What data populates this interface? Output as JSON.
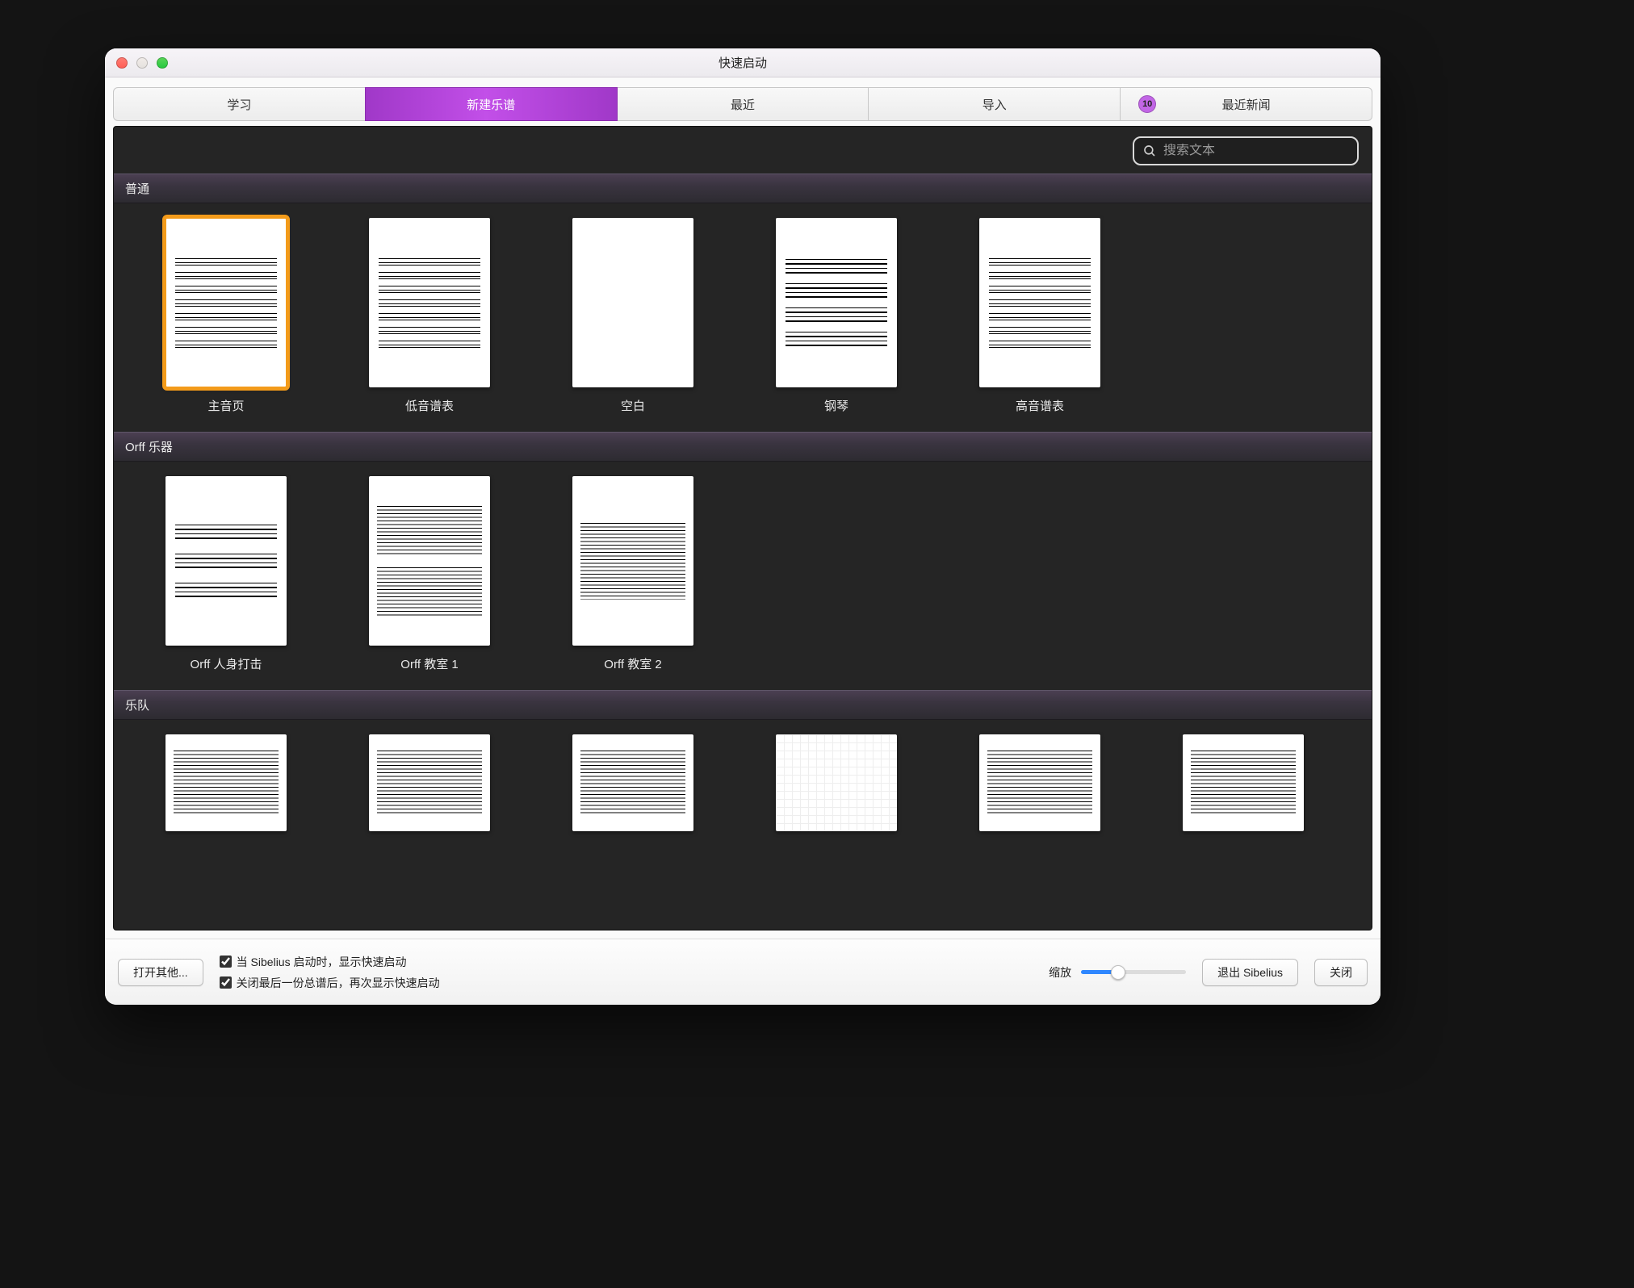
{
  "window": {
    "title": "快速启动"
  },
  "tabs": {
    "learn": "学习",
    "new_score": "新建乐谱",
    "recent": "最近",
    "import": "导入",
    "news": "最近新闻",
    "news_badge": "10"
  },
  "search": {
    "placeholder": "搜索文本"
  },
  "sections": {
    "common": {
      "title": "普通",
      "items": {
        "lead_sheet": "主音页",
        "bass_staff": "低音谱表",
        "blank": "空白",
        "piano": "钢琴",
        "treble_staff": "高音谱表"
      }
    },
    "orff": {
      "title": "Orff 乐器",
      "items": {
        "body_perc": "Orff 人身打击",
        "classroom1": "Orff 教室 1",
        "classroom2": "Orff 教室 2"
      }
    },
    "ensemble": {
      "title": "乐队"
    }
  },
  "bottom": {
    "open_other": "打开其他...",
    "check_show_on_start": "当 Sibelius 启动时，显示快速启动",
    "check_show_after_close": "关闭最后一份总谱后，再次显示快速启动",
    "zoom_label": "缩放",
    "quit": "退出 Sibelius",
    "close": "关闭"
  }
}
